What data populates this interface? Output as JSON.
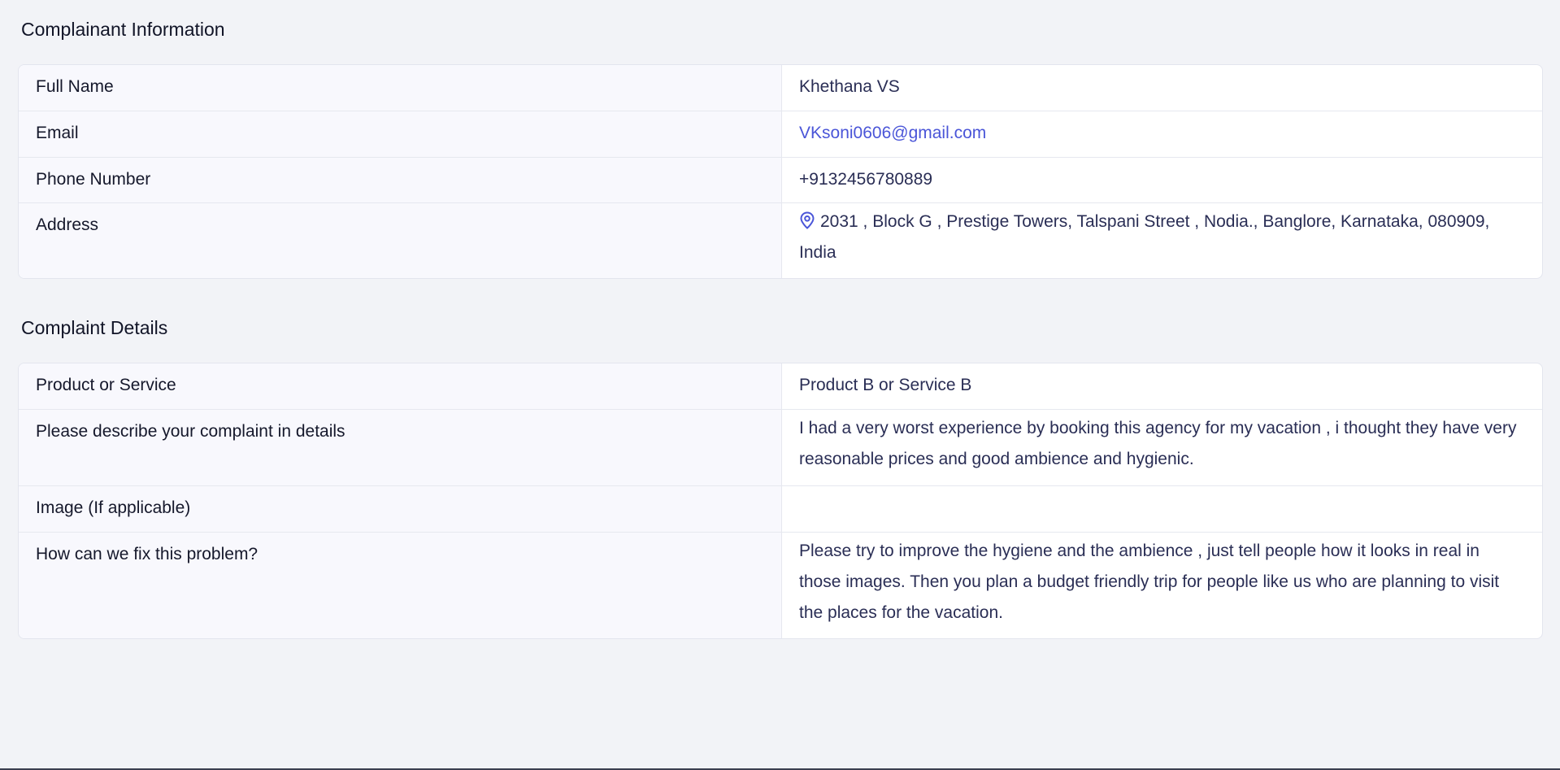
{
  "complainant": {
    "title": "Complainant Information",
    "rows": [
      {
        "label": "Full Name",
        "value": "Khethana VS"
      },
      {
        "label": "Email",
        "value": "VKsoni0606@gmail.com"
      },
      {
        "label": "Phone Number",
        "value": "+9132456780889"
      },
      {
        "label": "Address",
        "value": "2031 , Block G , Prestige Towers, Talspani Street , Nodia., Banglore, Karnataka, 080909, India"
      }
    ]
  },
  "complaint": {
    "title": "Complaint Details",
    "rows": [
      {
        "label": "Product or Service",
        "value": "Product B or Service B"
      },
      {
        "label": "Please describe your complaint in details",
        "value": "I had a very worst experience by booking this agency for my vacation ,  i thought they have very reasonable prices and good ambience and hygienic."
      },
      {
        "label": "Image (If applicable)",
        "value": ""
      },
      {
        "label": "How can we fix this problem?",
        "value": "Please try to improve the hygiene and the ambience , just tell people how it looks in real in those images. Then you plan a budget friendly trip for people like us who are planning to visit the places for the vacation."
      }
    ]
  },
  "colors": {
    "background": "#f2f3f7",
    "link": "#4a55d8",
    "icon": "#4a55d8"
  },
  "icons": {
    "address": "map-pin-icon"
  }
}
